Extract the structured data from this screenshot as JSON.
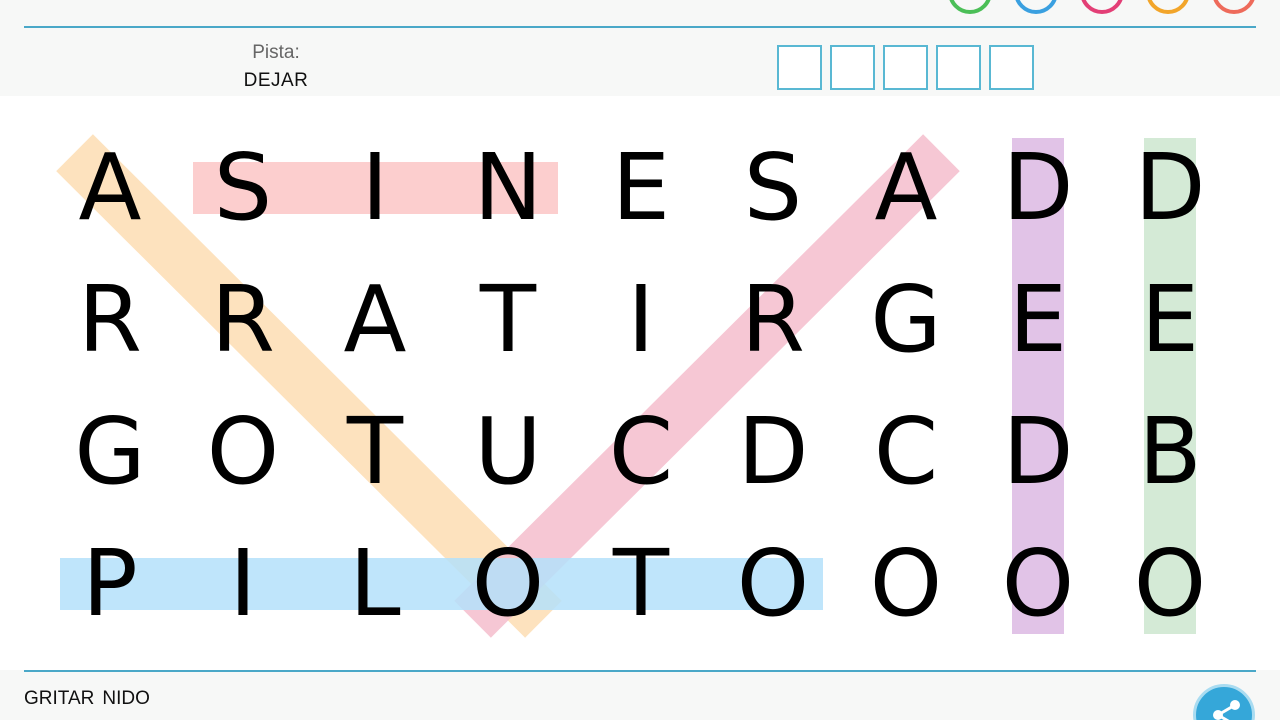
{
  "hint": {
    "label": "Pista:",
    "word": "DEJAR",
    "answer_length": 5
  },
  "top_icons": [
    {
      "name": "green-icon",
      "color": "#4bbf57"
    },
    {
      "name": "help-icon",
      "color": "#3aa0e0"
    },
    {
      "name": "pink-icon",
      "color": "#e33f76"
    },
    {
      "name": "orange-icon",
      "color": "#f2a52a"
    },
    {
      "name": "close-icon",
      "color": "#ee6b5b"
    }
  ],
  "grid": {
    "rows": [
      [
        "A",
        "S",
        "I",
        "N",
        "E",
        "S",
        "A",
        "D",
        "D"
      ],
      [
        "R",
        "R",
        "A",
        "T",
        "I",
        "R",
        "G",
        "E",
        "E"
      ],
      [
        "G",
        "O",
        "T",
        "U",
        "C",
        "D",
        "C",
        "D",
        "B"
      ],
      [
        "P",
        "I",
        "L",
        "O",
        "T",
        "O",
        "O",
        "O",
        "O"
      ]
    ]
  },
  "found_highlights": [
    {
      "color": "#fcc6c6",
      "from": [
        0,
        1
      ],
      "to": [
        0,
        3
      ]
    },
    {
      "color": "#fdddb3",
      "from": [
        0,
        0
      ],
      "to": [
        3,
        3
      ]
    },
    {
      "color": "#f5bdcc",
      "from": [
        0,
        6
      ],
      "to": [
        3,
        3
      ]
    },
    {
      "color": "#b4e1fa",
      "from": [
        3,
        0
      ],
      "to": [
        3,
        5
      ]
    },
    {
      "color": "#dcb8e3",
      "from": [
        0,
        7
      ],
      "to": [
        3,
        7
      ]
    },
    {
      "color": "#cce6cf",
      "from": [
        0,
        8
      ],
      "to": [
        3,
        8
      ]
    }
  ],
  "found_words": [
    "GRITAR",
    "NIDO"
  ],
  "share_icon": "share-icon"
}
